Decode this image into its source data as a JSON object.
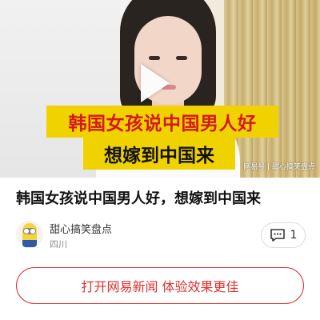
{
  "video": {
    "overlay_title": "韩国女孩说中国男人好",
    "overlay_subtitle": "想嫁到中国来",
    "watermark": "网易号 | 甜心搞笑盘点",
    "play_icon": "play-icon"
  },
  "article": {
    "title": "韩国女孩说中国男人好，想嫁到中国来"
  },
  "author": {
    "name": "甜心搞笑盘点",
    "location": "四川",
    "avatar_icon": "minion-avatar"
  },
  "comments": {
    "icon": "comment-icon",
    "count": "1"
  },
  "cta": {
    "label": "打开网易新闻 体验效果更佳"
  },
  "colors": {
    "accent": "#e0312d",
    "overlay_bg": "#f0d200",
    "overlay_title_text": "#d4181d"
  }
}
